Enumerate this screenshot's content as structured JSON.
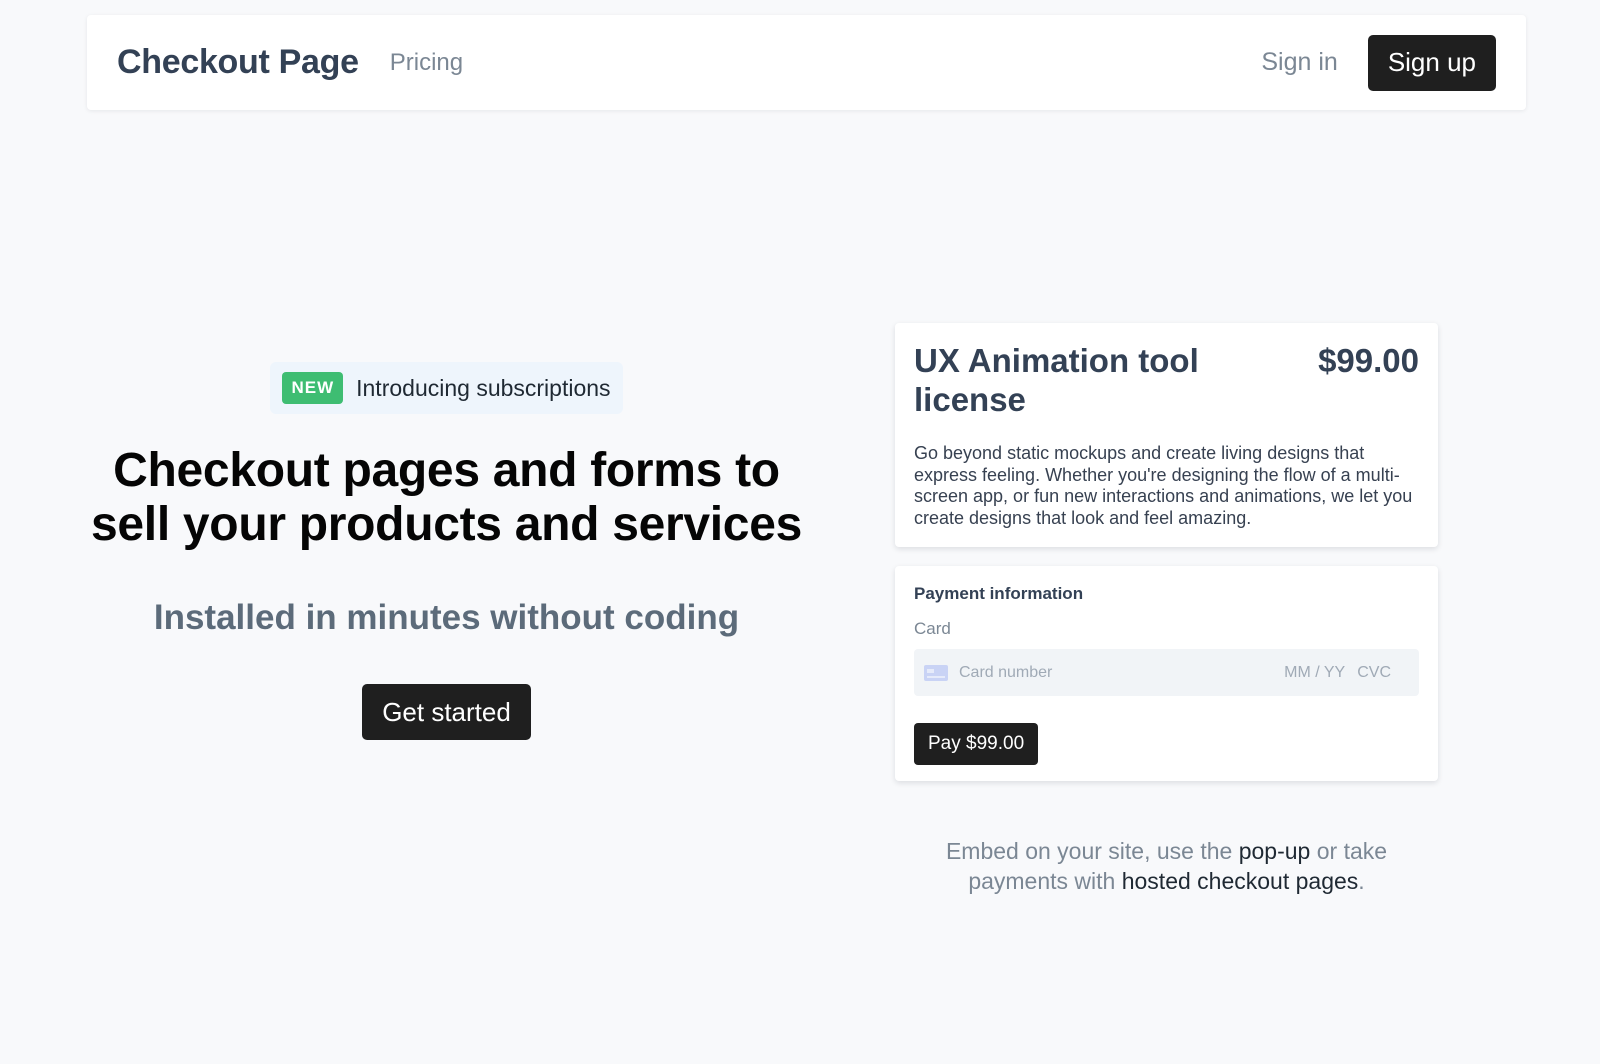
{
  "navbar": {
    "brand": "Checkout Page",
    "pricing_link": "Pricing",
    "signin_link": "Sign in",
    "signup_button": "Sign up"
  },
  "hero": {
    "badge": "NEW",
    "announcement": "Introducing subscriptions",
    "headline_line1": "Checkout pages and forms to",
    "headline_line2": "sell your products and services",
    "subheadline": "Installed in minutes without coding",
    "cta_button": "Get started"
  },
  "product": {
    "title": "UX Animation tool license",
    "price": "$99.00",
    "description": "Go beyond static mockups and create living designs that express feeling. Whether you're designing the flow of a multi-screen app, or fun new interactions and animations, we let you create designs that look and feel amazing."
  },
  "payment": {
    "title": "Payment information",
    "card_label": "Card",
    "card_number_placeholder": "Card number",
    "expiry_placeholder": "MM / YY",
    "cvc_placeholder": "CVC",
    "pay_button": "Pay $99.00"
  },
  "embed": {
    "part1": "Embed on your site, use the ",
    "popup_link": "pop-up",
    "part2": " or take payments with ",
    "hosted_link": "hosted checkout pages",
    "part3": "."
  },
  "colors": {
    "background": "#f8f9fb",
    "button": "#1f1f1f",
    "badge": "#3ebd72",
    "heading": "#334155",
    "muted": "#7b8794"
  },
  "icons": {
    "card_icon": "credit-card-icon"
  }
}
